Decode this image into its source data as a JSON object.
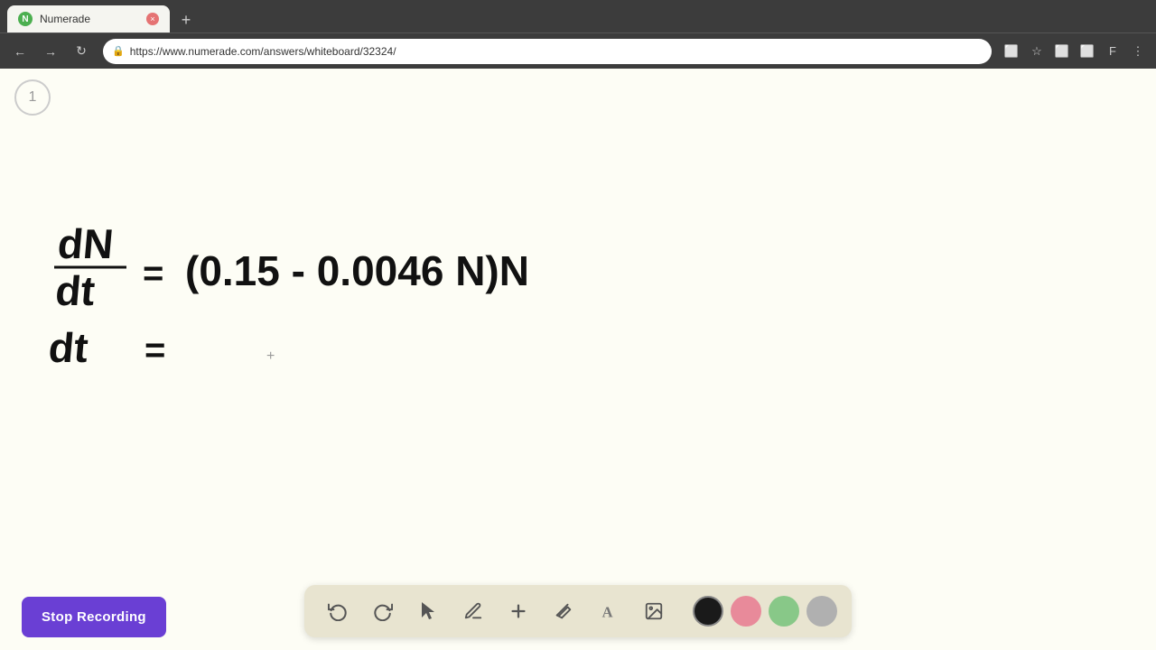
{
  "browser": {
    "tab_title": "Numerade",
    "tab_favicon_letter": "N",
    "url": "https://www.numerade.com/answers/whiteboard/32324/",
    "new_tab_label": "+",
    "nav": {
      "back": "←",
      "forward": "→",
      "refresh": "↻",
      "menu": "⋮"
    }
  },
  "page": {
    "page_number": "1",
    "cursor_symbol": "+",
    "stop_recording_label": "Stop Recording"
  },
  "toolbar": {
    "tools": [
      {
        "name": "undo",
        "icon": "↺",
        "label": "Undo"
      },
      {
        "name": "redo",
        "icon": "↻",
        "label": "Redo"
      },
      {
        "name": "select",
        "icon": "▲",
        "label": "Select"
      },
      {
        "name": "pen",
        "icon": "✏",
        "label": "Pen"
      },
      {
        "name": "add",
        "icon": "+",
        "label": "Add"
      },
      {
        "name": "eraser",
        "icon": "◈",
        "label": "Eraser"
      },
      {
        "name": "text",
        "icon": "A",
        "label": "Text"
      },
      {
        "name": "image",
        "icon": "🖼",
        "label": "Image"
      }
    ],
    "colors": [
      {
        "name": "black",
        "value": "#1a1a1a",
        "active": true
      },
      {
        "name": "pink",
        "value": "#e88a9a"
      },
      {
        "name": "green",
        "value": "#88c888"
      },
      {
        "name": "gray",
        "value": "#b0b0b0"
      }
    ]
  }
}
